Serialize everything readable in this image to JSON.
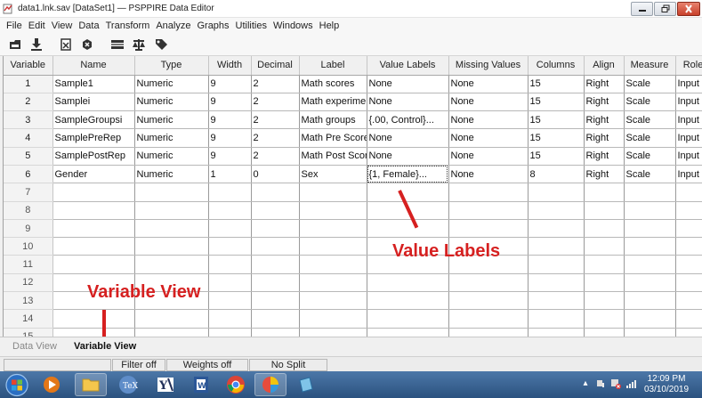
{
  "window": {
    "title": "data1.lnk.sav [DataSet1] — PSPPIRE Data Editor"
  },
  "menu": [
    "File",
    "Edit",
    "View",
    "Data",
    "Transform",
    "Analyze",
    "Graphs",
    "Utilities",
    "Windows",
    "Help"
  ],
  "toolbar_icons": [
    "open-file-icon",
    "save-icon",
    "goto-case-icon",
    "goto-variable-icon",
    "insert-case-icon",
    "split-file-icon",
    "value-labels-icon"
  ],
  "grid": {
    "columns": [
      "Variable",
      "Name",
      "Type",
      "Width",
      "Decimal",
      "Label",
      "Value Labels",
      "Missing Values",
      "Columns",
      "Align",
      "Measure",
      "Role"
    ],
    "rows": [
      [
        "1",
        "Sample1",
        "Numeric",
        "9",
        "2",
        "Math scores",
        "None",
        "None",
        "15",
        "Right",
        "Scale",
        "Input"
      ],
      [
        "2",
        "Samplei",
        "Numeric",
        "9",
        "2",
        "Math experimen",
        "None",
        "None",
        "15",
        "Right",
        "Scale",
        "Input"
      ],
      [
        "3",
        "SampleGroupsi",
        "Numeric",
        "9",
        "2",
        "Math groups",
        "{.00, Control}...",
        "None",
        "15",
        "Right",
        "Scale",
        "Input"
      ],
      [
        "4",
        "SamplePreRep",
        "Numeric",
        "9",
        "2",
        "Math Pre Score",
        "None",
        "None",
        "15",
        "Right",
        "Scale",
        "Input"
      ],
      [
        "5",
        "SamplePostRep",
        "Numeric",
        "9",
        "2",
        "Math Post Score",
        "None",
        "None",
        "15",
        "Right",
        "Scale",
        "Input"
      ],
      [
        "6",
        "Gender",
        "Numeric",
        "1",
        "0",
        "Sex",
        "{1, Female}...",
        "None",
        "8",
        "Right",
        "Scale",
        "Input"
      ]
    ],
    "empty_rows": [
      "7",
      "8",
      "9",
      "10",
      "11",
      "12",
      "13",
      "14",
      "15"
    ]
  },
  "tabs": {
    "data_view": "Data View",
    "variable_view": "Variable View"
  },
  "status": {
    "filter": "Filter off",
    "weights": "Weights off",
    "split": "No Split"
  },
  "annotations": {
    "value_labels": "Value Labels",
    "variable_view": "Variable View"
  },
  "taskbar": {
    "time": "12:09 PM",
    "date": "03/10/2019"
  },
  "colors": {
    "annotation": "#d62020",
    "taskbar": "#2b527f",
    "close_button": "#c8402b"
  }
}
